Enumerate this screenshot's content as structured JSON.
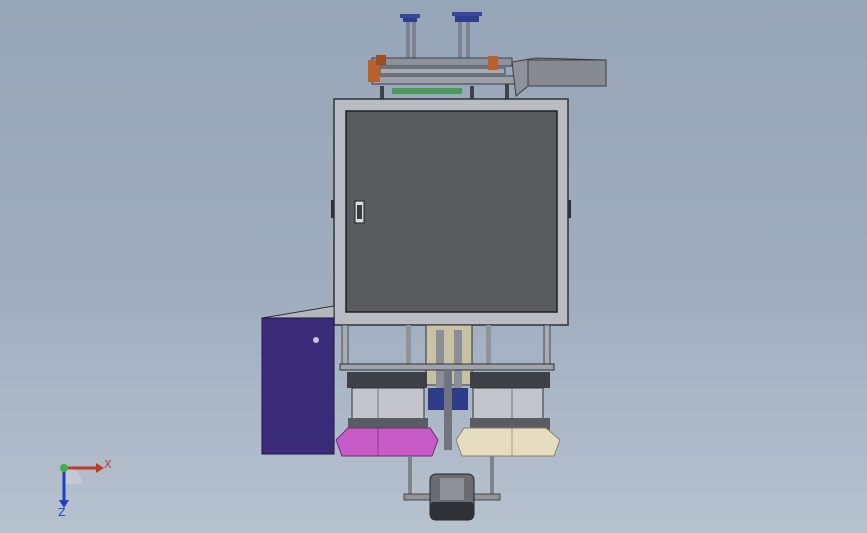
{
  "view": {
    "background_top": "#97a5b8",
    "background_bottom": "#b7c2cf"
  },
  "model": {
    "cabinet_color": "#5a5b5f",
    "frame_color": "#b9bcc2",
    "side_panel_color": "#3b2c7a",
    "pink_fixture_color": "#c75bc7",
    "cream_fixture_color": "#e6dcc0"
  },
  "triad": {
    "x_label": "X",
    "z_label": "Z",
    "x_color": "#c23a2a",
    "z_color": "#1f3fbf",
    "y_color": "#3cb04a"
  }
}
